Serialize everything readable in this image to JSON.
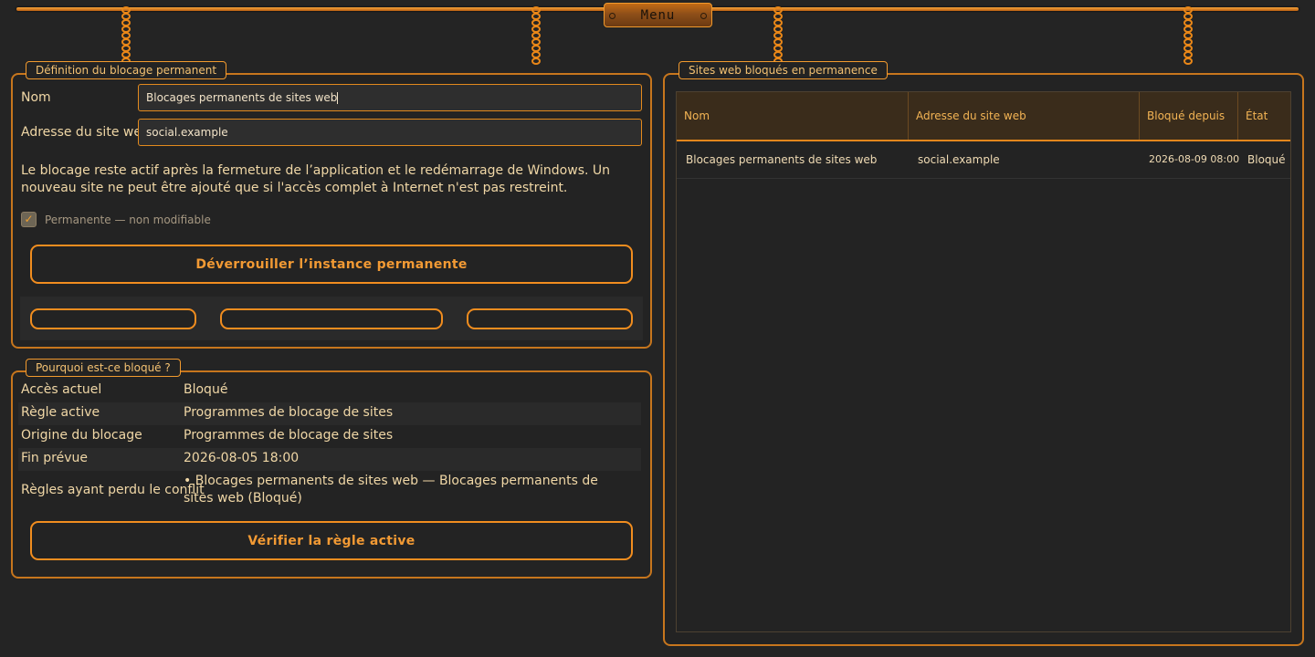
{
  "menu": {
    "label": "Menu"
  },
  "definition": {
    "legend": "Définition du blocage permanent",
    "name_label": "Nom",
    "name_value": "Blocages permanents de sites web",
    "address_label": "Adresse du site web",
    "address_value": "social.example",
    "note": "Le blocage reste actif après la fermeture de l’application et le redémarrage de Windows. Un nouveau site ne peut être ajouté que si l'accès complet à Internet n'est pas restreint.",
    "permanent_label": "Permanente — non modifiable",
    "permanent_checked": true,
    "unlock_button": "Déverrouiller l’instance permanente"
  },
  "why": {
    "legend": "Pourquoi est-ce bloqué ?",
    "rows": [
      {
        "key": "Accès actuel",
        "value": "Bloqué"
      },
      {
        "key": "Règle active",
        "value": "Programmes de blocage de sites"
      },
      {
        "key": "Origine du blocage",
        "value": "Programmes de blocage de sites"
      },
      {
        "key": "Fin prévue",
        "value": "2026-08-05 18:00"
      }
    ],
    "lost_key": "Règles ayant perdu le conflit",
    "lost_value": "• Blocages permanents de sites web — Blocages permanents de sites web (Bloqué)",
    "verify_button": "Vérifier la règle active"
  },
  "sites": {
    "legend": "Sites web bloqués en permanence",
    "columns": [
      "Nom",
      "Adresse du site web",
      "Bloqué depuis",
      "État"
    ],
    "rows": [
      [
        "Blocages permanents de sites web",
        "social.example",
        "2026-08-09 08:00",
        "Bloqué"
      ]
    ]
  },
  "colors": {
    "accent": "#f18d1f",
    "background": "#242424",
    "header": "#3a2c1b",
    "text": "#f0d7a6"
  }
}
